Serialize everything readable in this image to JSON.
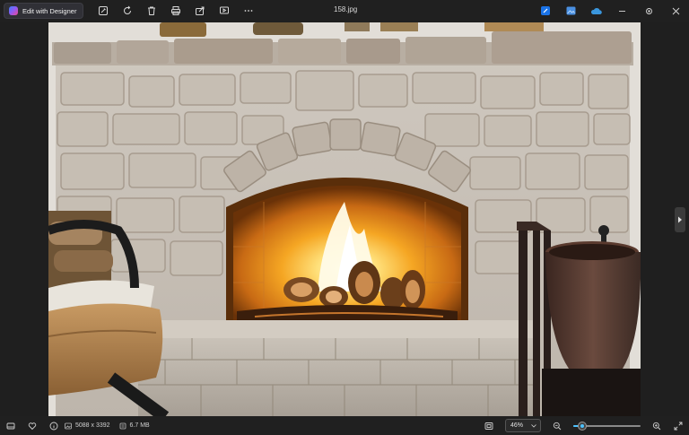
{
  "toolbar": {
    "designer_label": "Edit with Designer",
    "filename": "158.jpg",
    "tools": [
      {
        "name": "edit-icon"
      },
      {
        "name": "rotate-icon"
      },
      {
        "name": "delete-icon"
      },
      {
        "name": "print-icon"
      },
      {
        "name": "share-icon"
      },
      {
        "name": "slideshow-icon"
      },
      {
        "name": "more-icon"
      }
    ],
    "apps": [
      {
        "name": "clipchamp-icon",
        "color": "#1a73e8"
      },
      {
        "name": "gallery-icon",
        "color": "#4a90e2"
      },
      {
        "name": "onedrive-icon",
        "color": "#3a96dd"
      }
    ]
  },
  "status": {
    "dimensions": "5088 x 3392",
    "filesize": "6.7 MB",
    "zoom": "46%",
    "zoom_fraction": 0.08
  },
  "colors": {
    "accent": "#4cc2ff",
    "background": "#202020"
  }
}
